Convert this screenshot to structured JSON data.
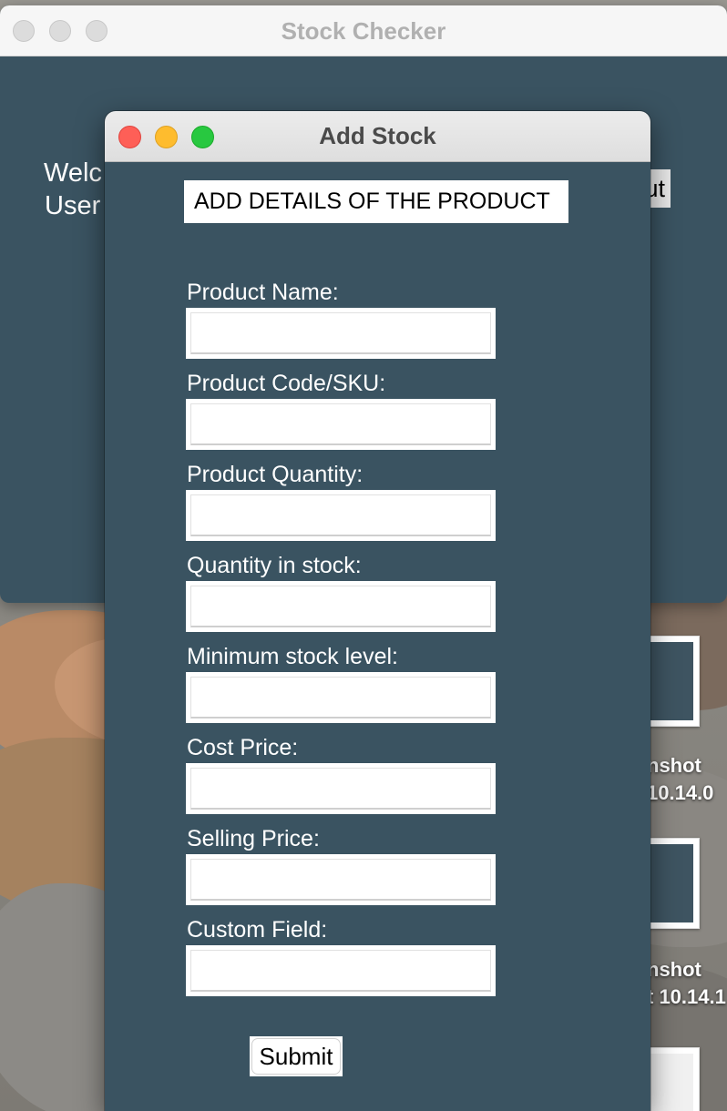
{
  "main_window": {
    "title": "Stock Checker",
    "welcome_line1": "Welc",
    "welcome_line2": "User",
    "logout_partial": "ut"
  },
  "dialog": {
    "title": "Add Stock",
    "heading": "ADD DETAILS OF THE PRODUCT",
    "fields": [
      {
        "label": "Product Name:",
        "value": ""
      },
      {
        "label": "Product Code/SKU:",
        "value": ""
      },
      {
        "label": "Product Quantity:",
        "value": ""
      },
      {
        "label": "Quantity in stock:",
        "value": ""
      },
      {
        "label": "Minimum stock level:",
        "value": ""
      },
      {
        "label": "Cost Price:",
        "value": ""
      },
      {
        "label": "Selling Price:",
        "value": ""
      },
      {
        "label": "Custom Field:",
        "value": ""
      }
    ],
    "submit_label": "Submit"
  },
  "desktop": {
    "files": [
      {
        "label_line1": "nshot",
        "label_line2": "10.14.0"
      },
      {
        "label_line1": "nshot",
        "label_line2": "t 10.14.1"
      }
    ]
  },
  "colors": {
    "window_bg": "#3a5361",
    "close": "#fe5f57",
    "minimize": "#febc2e",
    "maximize": "#28c840"
  }
}
